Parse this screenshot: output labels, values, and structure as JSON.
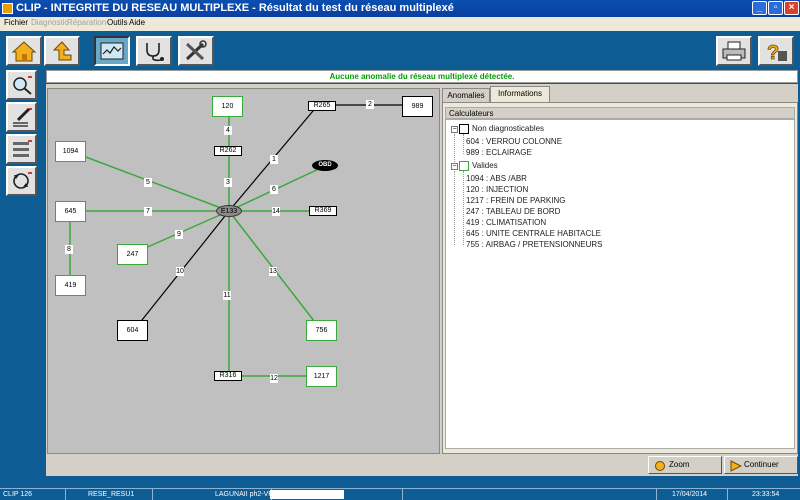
{
  "window": {
    "title": "CLIP - INTEGRITE DU RESEAU MULTIPLEXE - Résultat du test du réseau multiplexé",
    "min": "_",
    "max": "▫",
    "close": "×"
  },
  "menu": [
    {
      "label": "Fichier",
      "enabled": true
    },
    {
      "label": "Diagnostic",
      "enabled": false
    },
    {
      "label": "Réparation",
      "enabled": false
    },
    {
      "label": "Outils",
      "enabled": true
    },
    {
      "label": "Aide",
      "enabled": true
    }
  ],
  "message": "Aucune anomalie du réseau multiplexé détectée.",
  "diagram": {
    "hub": "E133",
    "obd": "OBD",
    "nodes": {
      "n120": "120",
      "n989": "989",
      "nR265": "R265",
      "nR262": "R262",
      "n1094": "1094",
      "n645": "645",
      "n247": "247",
      "n419": "419",
      "nR369": "R369",
      "n604": "604",
      "n756": "756",
      "nR316": "R316",
      "n1217": "1217"
    },
    "links": {
      "l1": "1",
      "l2": "2",
      "l3": "3",
      "l4": "4",
      "l5": "5",
      "l6": "6",
      "l7": "7",
      "l8": "8",
      "l9": "9",
      "l10": "10",
      "l11": "11",
      "l12": "12",
      "l13": "13",
      "l14": "14"
    }
  },
  "tabs": {
    "anomalies": "Anomalies",
    "informations": "Informations"
  },
  "calculateurs": {
    "header": "Calculateurs",
    "group1": {
      "label": "Non diagnosticables",
      "items": [
        "604 : VERROU COLONNE",
        "989 : ECLAIRAGE"
      ]
    },
    "group2": {
      "label": "Valides",
      "items": [
        "1094 : ABS /ABR",
        "120 : INJECTION",
        "1217 : FREIN DE PARKING",
        "247 : TABLEAU DE BORD",
        "419 : CLIMATISATION",
        "645 : UNITE CENTRALE HABITACLE",
        "755 : AIRBAG / PRETENSIONNEURS"
      ]
    }
  },
  "buttons": {
    "zoom": "Zoom",
    "continue": "Continuer"
  },
  "status": {
    "version": "CLIP 126",
    "screen": "RESE_RESU1",
    "vehicle": "LAGUNAII ph2-VF",
    "date": "17/04/2014",
    "time": "23:33:54"
  },
  "colors": {
    "green_link": "#3aa83a",
    "black_link": "#000000",
    "message_green": "#0a9a0a",
    "background_blue": "#0d5c94"
  },
  "icons": [
    "home-icon",
    "back-arrow-icon",
    "monitor-graph-icon",
    "stethoscope-icon",
    "tools-icon",
    "printer-icon",
    "help-icon",
    "magnifier-icon",
    "pencil-list-icon",
    "settings-list-icon",
    "network-cycle-icon"
  ]
}
